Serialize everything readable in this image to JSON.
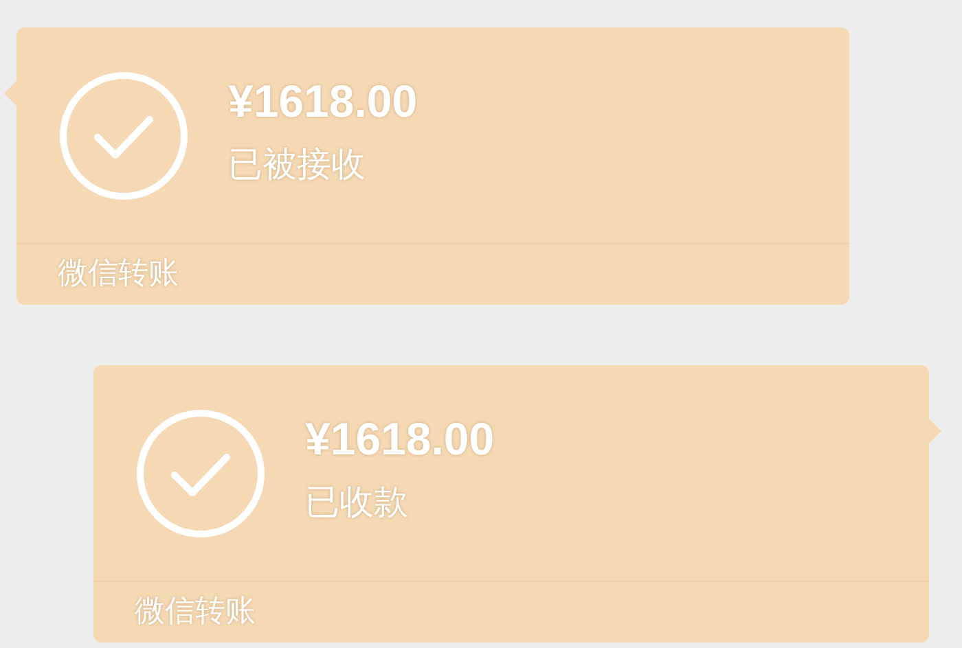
{
  "messages": [
    {
      "kind": "incoming",
      "amount": "¥1618.00",
      "status": "已被接收",
      "footer": "微信转账"
    },
    {
      "kind": "outgoing",
      "amount": "¥1618.00",
      "status": "已收款",
      "footer": "微信转账"
    }
  ]
}
